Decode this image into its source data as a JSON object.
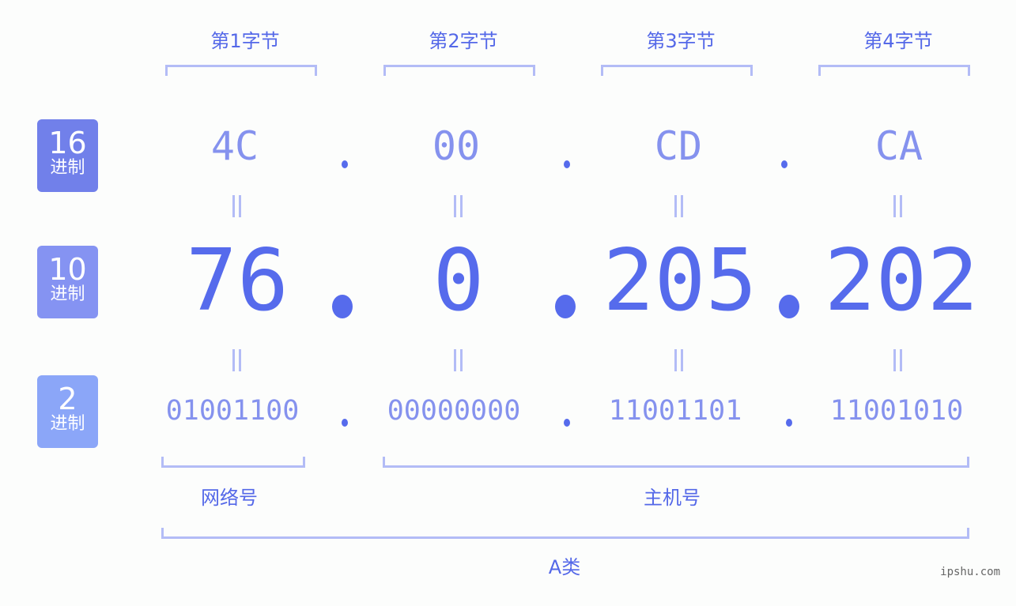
{
  "bytes": [
    {
      "label": "第1字节",
      "hex": "4C",
      "dec": "76",
      "bin": "01001100"
    },
    {
      "label": "第2字节",
      "hex": "00",
      "dec": "0",
      "bin": "00000000"
    },
    {
      "label": "第3字节",
      "hex": "CD",
      "dec": "205",
      "bin": "11001101"
    },
    {
      "label": "第4字节",
      "hex": "CA",
      "dec": "202",
      "bin": "11001010"
    }
  ],
  "badges": {
    "hex": {
      "num": "16",
      "unit": "进制",
      "color": "#7180ea"
    },
    "dec": {
      "num": "10",
      "unit": "进制",
      "color": "#8593f2"
    },
    "bin": {
      "num": "2",
      "unit": "进制",
      "color": "#8ba6f8"
    }
  },
  "parts": {
    "network": "网络号",
    "host": "主机号",
    "class": "A类"
  },
  "watermark": "ipshu.com",
  "colors": {
    "accent": "#566bec",
    "light": "#8592ee",
    "bracket": "#b3bcf6"
  }
}
